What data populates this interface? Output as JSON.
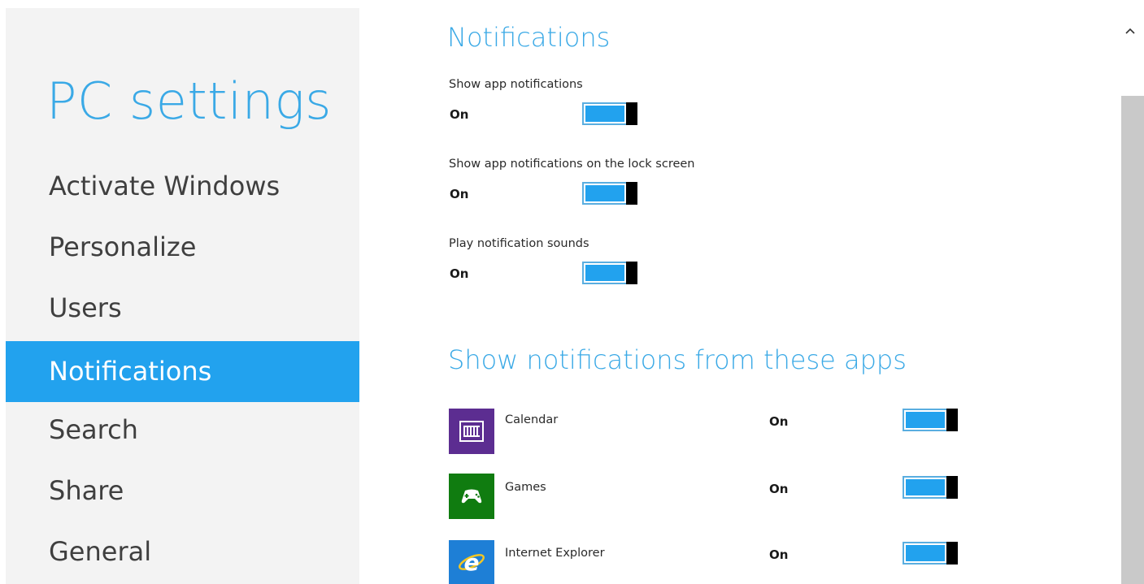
{
  "nav": {
    "title": "PC settings",
    "items": [
      {
        "label": "Activate Windows",
        "selected": false
      },
      {
        "label": "Personalize",
        "selected": false
      },
      {
        "label": "Users",
        "selected": false
      },
      {
        "label": "Notifications",
        "selected": true
      },
      {
        "label": "Search",
        "selected": false
      },
      {
        "label": "Share",
        "selected": false
      },
      {
        "label": "General",
        "selected": false
      }
    ]
  },
  "content": {
    "section_title": "Notifications",
    "settings": [
      {
        "label": "Show app notifications",
        "state": "On"
      },
      {
        "label": "Show app notifications on the lock screen",
        "state": "On"
      },
      {
        "label": "Play notification sounds",
        "state": "On"
      }
    ],
    "apps_section_title": "Show notifications from these apps",
    "apps": [
      {
        "name": "Calendar",
        "state": "On",
        "icon": "calendar-icon",
        "color": "#5c2d91"
      },
      {
        "name": "Games",
        "state": "On",
        "icon": "game-controller-icon",
        "color": "#107c10"
      },
      {
        "name": "Internet Explorer",
        "state": "On",
        "icon": "internet-explorer-icon",
        "color": "#1e7fd6"
      }
    ]
  },
  "scrollbar": {
    "up_icon": "chevron-up-icon"
  },
  "colors": {
    "accent": "#22a2ee",
    "title": "#3aa9e6",
    "nav_background": "#f3f3f3",
    "toggle_thumb": "#000000"
  }
}
